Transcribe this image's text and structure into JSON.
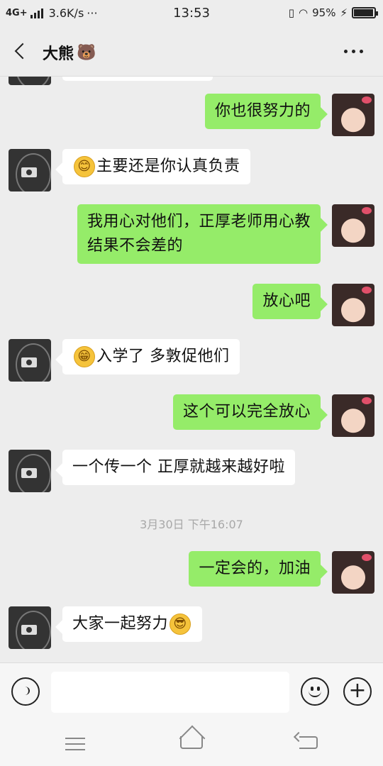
{
  "status_bar": {
    "network": "4G+",
    "speed": "3.6K/s",
    "more": "···",
    "time": "13:53",
    "battery_text": "95%",
    "battery_level": 0.95
  },
  "header": {
    "back_icon": "chevron-left-icon",
    "title": "大熊",
    "title_emoji": "🐻",
    "more_icon": "more-dots-icon"
  },
  "messages": [
    {
      "sender": "me",
      "text": "你也很努力的"
    },
    {
      "sender": "other",
      "emoji": "😊",
      "text": "主要还是你认真负责"
    },
    {
      "sender": "me",
      "lines": [
        "我用心对他们，正厚老师用心教",
        "结果不会差的"
      ]
    },
    {
      "sender": "me",
      "text": "放心吧"
    },
    {
      "sender": "other",
      "emoji": "😁",
      "text": "入学了  多敦促他们"
    },
    {
      "sender": "me",
      "text": "这个可以完全放心"
    },
    {
      "sender": "other",
      "text": "一个传一个  正厚就越来越好啦"
    },
    {
      "timestamp": "3月30日 下午16:07"
    },
    {
      "sender": "me",
      "text": "一定会的，加油"
    },
    {
      "sender": "other",
      "text": "大家一起努力",
      "emoji_after": "😎"
    }
  ],
  "input_bar": {
    "voice_icon": "voice-icon",
    "placeholder": "",
    "emoji_icon": "emoji-icon",
    "plus_icon": "plus-icon",
    "plus_label": "+"
  },
  "nav_bar": {
    "menu_icon": "menu-icon",
    "home_icon": "home-icon",
    "back_icon": "back-icon"
  }
}
